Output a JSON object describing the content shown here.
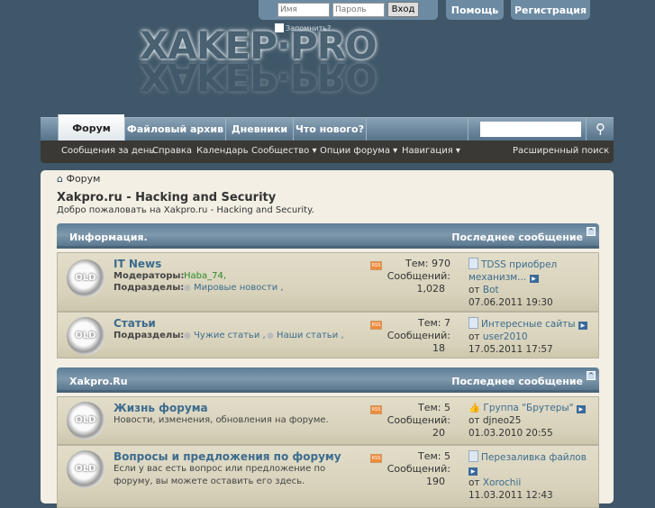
{
  "header": {
    "login_placeholder": "Имя",
    "password_placeholder": "Пароль",
    "login_button": "Вход",
    "remember": "Запомнить?",
    "help": "Помощь",
    "register": "Регистрация",
    "logo": "XAKEP·PRO"
  },
  "nav": {
    "tabs": [
      "Форум",
      "Файловый архив",
      "Дневники",
      "Что нового?"
    ],
    "search_icon": "magnifier"
  },
  "subnav": {
    "items": [
      "Сообщения за день",
      "Справка",
      "Календарь",
      "Сообщество ▾",
      "Опции форума ▾",
      "Навигация ▾"
    ],
    "advanced_search": "Расширенный поиск"
  },
  "breadcrumb": "Форум",
  "page": {
    "title": "Xakpro.ru - Hacking and Security",
    "welcome": "Добро пожаловать на Xakpro.ru - Hacking and Security."
  },
  "categories": [
    {
      "name": "Информация.",
      "last_header": "Последнее сообщение",
      "forums": [
        {
          "title": "IT News",
          "moderators_label": "Модераторы:",
          "moderators": "Haba_74,",
          "sub_label": "Подразделы:",
          "subforums": [
            "Мировые новости ,"
          ],
          "threads": "Тем: 970",
          "posts_label": "Сообщений:",
          "posts": "1,028",
          "last_title": "TDSS приобрел механизм...",
          "by": "от",
          "user": "Bot",
          "date": "07.06.2011 19:30"
        },
        {
          "title": "Статьи",
          "sub_label": "Подразделы:",
          "subforums": [
            "Чужие статьи ,",
            "Наши статьи ,"
          ],
          "threads": "Тем: 7",
          "posts_label": "Сообщений:",
          "posts": "18",
          "last_title": "Интересные сайты",
          "by": "от",
          "user": "user2010",
          "date": "17.05.2011 17:57"
        }
      ]
    },
    {
      "name": "Xakpro.Ru",
      "last_header": "Последнее сообщение",
      "forums": [
        {
          "title": "Жизнь форума",
          "desc": "Новости, изменения, обновления на форуме.",
          "threads": "Тем: 5",
          "posts_label": "Сообщений:",
          "posts": "20",
          "last_title": "Группа \"Брутеры\"",
          "by": "от",
          "user": "djneo25",
          "date": "01.03.2010 20:55"
        },
        {
          "title": "Вопросы и предложения по форуму",
          "desc": "Если у вас есть вопрос или предложение по форуму, вы можете оставить его здесь.",
          "threads": "Тем: 5",
          "posts_label": "Сообщений:",
          "posts": "190",
          "last_title": "Перезаливка файлов",
          "by": "от",
          "user": "Xorochii",
          "date": "11.03.2011 12:43"
        }
      ]
    }
  ]
}
